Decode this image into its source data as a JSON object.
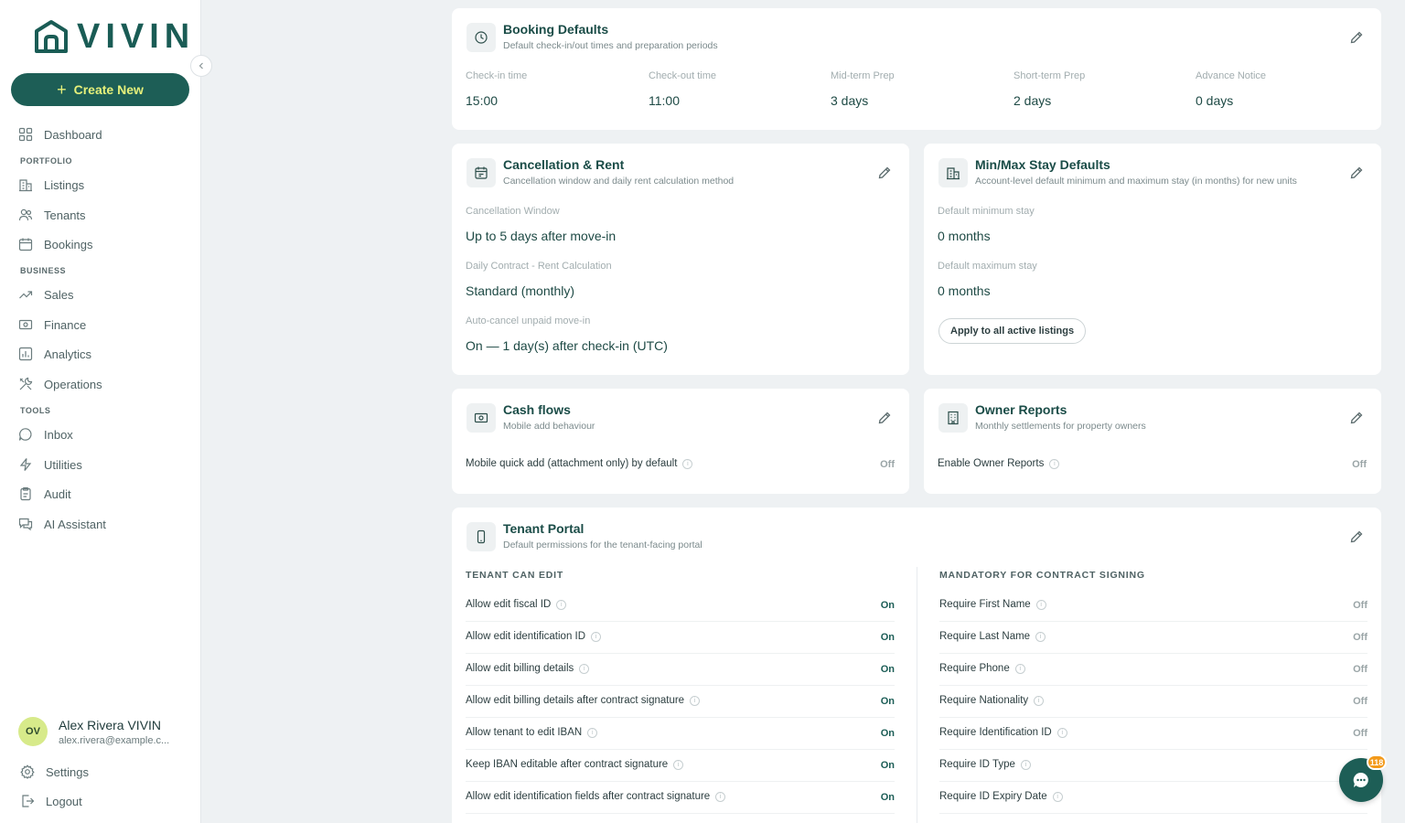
{
  "sidebar": {
    "logo_text": "VIVIN",
    "create_label": "Create New",
    "sections": {
      "portfolio": "PORTFOLIO",
      "business": "BUSINESS",
      "tools": "TOOLS"
    },
    "items": {
      "dashboard": "Dashboard",
      "listings": "Listings",
      "tenants": "Tenants",
      "bookings": "Bookings",
      "sales": "Sales",
      "finance": "Finance",
      "analytics": "Analytics",
      "operations": "Operations",
      "inbox": "Inbox",
      "utilities": "Utilities",
      "audit": "Audit",
      "ai_assistant": "AI Assistant"
    },
    "user": {
      "initials": "OV",
      "name": "Alex Rivera VIVIN",
      "email": "alex.rivera@example.c..."
    },
    "settings": "Settings",
    "logout": "Logout"
  },
  "booking": {
    "title": "Booking Defaults",
    "subtitle": "Default check-in/out times and preparation periods",
    "fields": [
      {
        "label": "Check-in time",
        "value": "15:00"
      },
      {
        "label": "Check-out time",
        "value": "11:00"
      },
      {
        "label": "Mid-term Prep",
        "value": "3 days"
      },
      {
        "label": "Short-term Prep",
        "value": "2 days"
      },
      {
        "label": "Advance Notice",
        "value": "0 days"
      }
    ]
  },
  "cancel": {
    "title": "Cancellation & Rent",
    "subtitle": "Cancellation window and daily rent calculation method",
    "fields": [
      {
        "label": "Cancellation Window",
        "value": "Up to 5 days after move-in"
      },
      {
        "label": "Daily Contract - Rent Calculation",
        "value": "Standard (monthly)"
      },
      {
        "label": "Auto-cancel unpaid move-in",
        "value": "On — 1 day(s) after check-in (UTC)"
      }
    ]
  },
  "minmax": {
    "title": "Min/Max Stay Defaults",
    "subtitle": "Account-level default minimum and maximum stay (in months) for new units",
    "fields": [
      {
        "label": "Default minimum stay",
        "value": "0 months"
      },
      {
        "label": "Default maximum stay",
        "value": "0 months"
      }
    ],
    "apply_label": "Apply to all active listings"
  },
  "cash": {
    "title": "Cash flows",
    "subtitle": "Mobile add behaviour",
    "row": {
      "label": "Mobile quick add (attachment only) by default",
      "value": "Off"
    }
  },
  "owner": {
    "title": "Owner Reports",
    "subtitle": "Monthly settlements for property owners",
    "row": {
      "label": "Enable Owner Reports",
      "value": "Off"
    }
  },
  "portal": {
    "title": "Tenant Portal",
    "subtitle": "Default permissions for the tenant-facing portal",
    "left_heading": "TENANT CAN EDIT",
    "right_heading": "MANDATORY FOR CONTRACT SIGNING",
    "left": [
      {
        "label": "Allow edit fiscal ID",
        "value": "On"
      },
      {
        "label": "Allow edit identification ID",
        "value": "On"
      },
      {
        "label": "Allow edit billing details",
        "value": "On"
      },
      {
        "label": "Allow edit billing details after contract signature",
        "value": "On"
      },
      {
        "label": "Allow tenant to edit IBAN",
        "value": "On"
      },
      {
        "label": "Keep IBAN editable after contract signature",
        "value": "On"
      },
      {
        "label": "Allow edit identification fields after contract signature",
        "value": "On"
      }
    ],
    "right": [
      {
        "label": "Require First Name",
        "value": "Off"
      },
      {
        "label": "Require Last Name",
        "value": "Off"
      },
      {
        "label": "Require Phone",
        "value": "Off"
      },
      {
        "label": "Require Nationality",
        "value": "Off"
      },
      {
        "label": "Require Identification ID",
        "value": "Off"
      },
      {
        "label": "Require ID Type",
        "value": ""
      },
      {
        "label": "Require ID Expiry Date",
        "value": ""
      }
    ]
  },
  "chat": {
    "badge": "118"
  },
  "colors": {
    "brand": "#1d5e56",
    "accent": "#e6f07a",
    "badge": "#f39a1a"
  }
}
